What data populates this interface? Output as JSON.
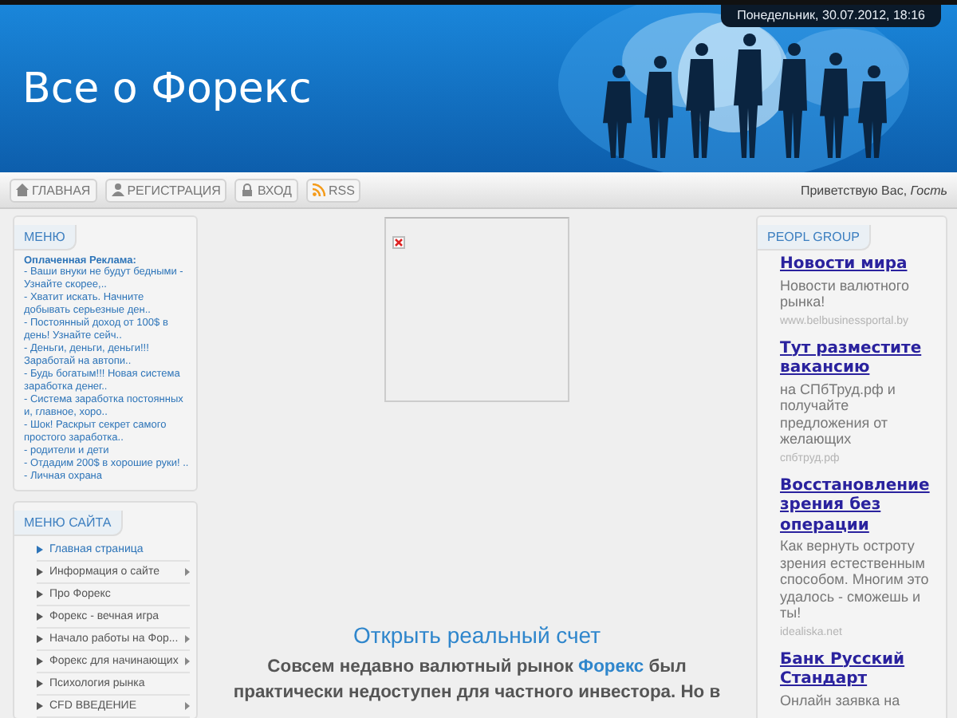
{
  "header": {
    "title": "Все о Форекс",
    "date": "Понедельник, 30.07.2012, 18:16"
  },
  "nav": {
    "items": [
      {
        "label": "ГЛАВНАЯ",
        "kind": "home"
      },
      {
        "label": "РЕГИСТРАЦИЯ",
        "kind": "user"
      },
      {
        "label": "ВХОД",
        "kind": "lock"
      },
      {
        "label": "RSS",
        "kind": "rss"
      }
    ],
    "greeting": "Приветствую Вас, *Гость*"
  },
  "ads_box": {
    "title": "МЕНЮ",
    "heading": "Оплаченная Реклама:",
    "items": [
      "- Ваши внуки не будут бедными - Узнайте скорее,..",
      "- Хватит искать. Начните добывать серьезные ден..",
      "- Постоянный доход от 100$ в день! Узнайте сейч..",
      "- Деньги, деньги, деньги!!! Заработай на автопи..",
      "- Будь богатым!!! Новая система заработка денег..",
      "- Система заработка постоянных и, главное, хоро..",
      "- Шок! Раскрыт секрет самого простого заработка..",
      "- родители и дети",
      "- Отдадим 200$ в хорошие руки! ..",
      "- Личная охрана"
    ]
  },
  "site_menu": {
    "title": "МЕНЮ САЙТА",
    "items": [
      {
        "label": "Главная страница",
        "selected": true,
        "submenu": false
      },
      {
        "label": "Информация о сайте",
        "selected": false,
        "submenu": true
      },
      {
        "label": "Про Форекс",
        "selected": false,
        "submenu": false
      },
      {
        "label": "Форекс - вечная игра",
        "selected": false,
        "submenu": false
      },
      {
        "label": "Начало работы на Фор...",
        "selected": false,
        "submenu": true
      },
      {
        "label": "Форекс для начинающих",
        "selected": false,
        "submenu": true
      },
      {
        "label": "Психология рынка",
        "selected": false,
        "submenu": false
      },
      {
        "label": "CFD ВВЕДЕНИЕ",
        "selected": false,
        "submenu": true
      }
    ]
  },
  "content": {
    "link": "Открыть реальный счет",
    "paragraph": {
      "before": "Совсем недавно валютный рынок ",
      "link": "Форекс",
      "after": " был практически недоступен для частного инвестора. Но в"
    }
  },
  "right_box": {
    "title": "PEOPL GROUP",
    "ads": [
      {
        "title": "Новости мира",
        "desc": "Новости валютного рынка!",
        "url": "www.belbusinessportal.by"
      },
      {
        "title": "Тут разместите вакансию",
        "desc": "на СПбТруд.рф и получайте предложения от желающих",
        "url": "спбтруд.рф"
      },
      {
        "title": "Восстановление зрения без операции",
        "desc": "Как вернуть остроту зрения естественным способом. Многим это удалось - сможешь и ты!",
        "url": "idealiska.net"
      },
      {
        "title": "Банк Русский Стандарт",
        "desc": "Онлайн заявка на"
      }
    ]
  }
}
